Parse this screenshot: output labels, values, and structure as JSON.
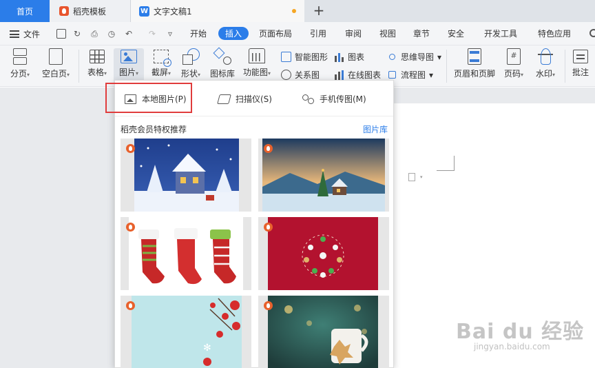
{
  "tabs": {
    "home": "首页",
    "template": "稻壳模板",
    "document": "文字文稿1",
    "add": "+"
  },
  "menu": {
    "file": "文件",
    "items": [
      "开始",
      "插入",
      "页面布局",
      "引用",
      "审阅",
      "视图",
      "章节",
      "安全",
      "开发工具",
      "特色应用"
    ],
    "active": "插入"
  },
  "ribbon": {
    "split": "分页",
    "blank_page": "空白页",
    "table": "表格",
    "picture": "图片",
    "screenshot": "截屏",
    "shape": "形状",
    "icon_library": "图标库",
    "function_chart": "功能图",
    "smart_art": "智能图形",
    "chart": "图表",
    "mind_map": "思维导图",
    "relation": "关系图",
    "online_chart": "在线图表",
    "flowchart": "流程图",
    "header_footer": "页眉和页脚",
    "page_number": "页码",
    "watermark": "水印",
    "comment": "批注",
    "page_number_glyph": "#",
    "caret": "▾"
  },
  "dropdown": {
    "local_picture": "本地图片(P)",
    "scanner": "扫描仪(S)",
    "phone_upload": "手机传图(M)",
    "section_title": "稻壳会员特权推荐",
    "library_link": "图片库"
  },
  "watermark": {
    "brand": "Bai du 经验",
    "url": "jingyan.baidu.com"
  },
  "colors": {
    "accent": "#2b7de9",
    "highlight": "#e03c3c",
    "badge": "#e8612c"
  }
}
